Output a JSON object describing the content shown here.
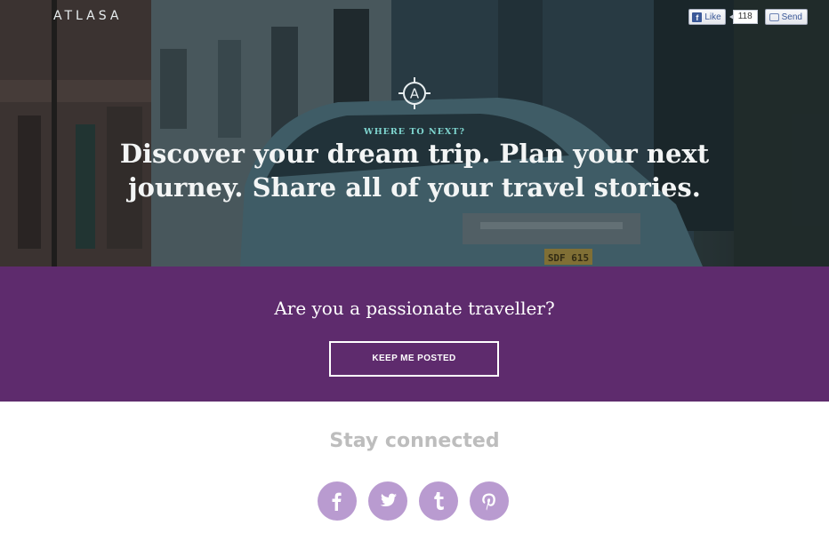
{
  "header": {
    "brand": "ATLASA",
    "facebook": {
      "like_label": "Like",
      "like_count": "118",
      "send_label": "Send"
    }
  },
  "hero": {
    "eyebrow": "WHERE TO NEXT?",
    "headline": "Discover your dream trip. Plan your next journey. Share all of your travel stories.",
    "license_plate": "SDF 615",
    "logo_letter": "A"
  },
  "cta": {
    "question": "Are you a passionate traveller?",
    "button_label": "KEEP ME POSTED"
  },
  "connect": {
    "title": "Stay connected",
    "icons": [
      {
        "name": "facebook-icon",
        "glyph": "f"
      },
      {
        "name": "twitter-icon",
        "glyph": "t"
      },
      {
        "name": "tumblr-icon",
        "glyph": "t"
      },
      {
        "name": "pinterest-icon",
        "glyph": "p"
      }
    ]
  },
  "colors": {
    "purple_band": "#5e2b6d",
    "eyebrow_teal": "#7fd6d0",
    "social_circle": "#b99bd0",
    "stay_gray": "#bdbdbd"
  }
}
